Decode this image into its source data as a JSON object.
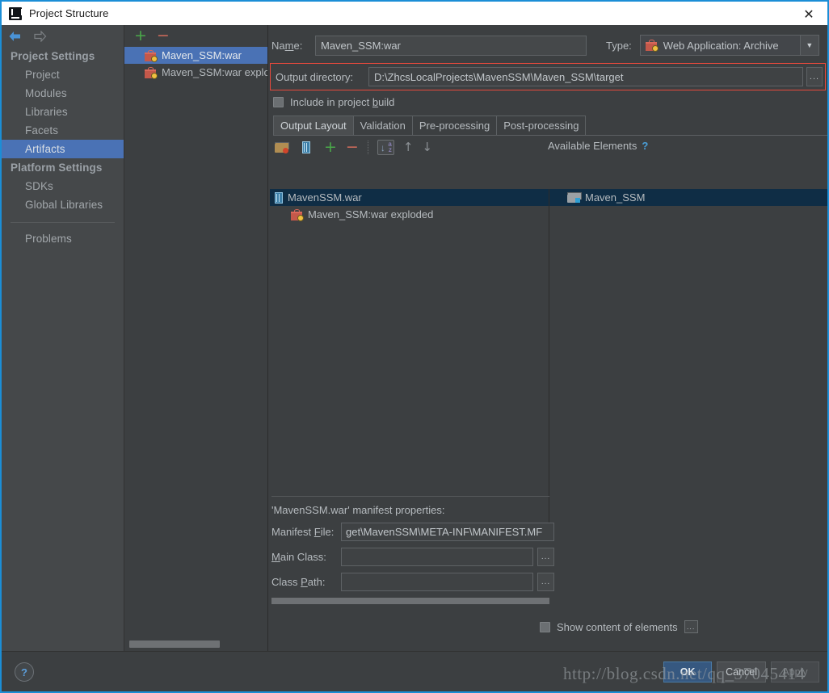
{
  "window": {
    "title": "Project Structure",
    "icon": "intellij-idea-icon",
    "close_label": "✕"
  },
  "nav": {
    "back_icon": "back-arrow-icon",
    "forward_icon": "forward-arrow-icon",
    "groups": [
      {
        "label": "Project Settings",
        "items": [
          {
            "label": "Project",
            "selected": false
          },
          {
            "label": "Modules",
            "selected": false
          },
          {
            "label": "Libraries",
            "selected": false
          },
          {
            "label": "Facets",
            "selected": false
          },
          {
            "label": "Artifacts",
            "selected": true
          }
        ]
      },
      {
        "label": "Platform Settings",
        "items": [
          {
            "label": "SDKs",
            "selected": false
          },
          {
            "label": "Global Libraries",
            "selected": false
          }
        ]
      }
    ],
    "problems_label": "Problems",
    "help_label": "?"
  },
  "artifacts_panel": {
    "add_label": "+",
    "remove_label": "−",
    "items": [
      {
        "label": "Maven_SSM:war",
        "selected": true
      },
      {
        "label": "Maven_SSM:war exploded",
        "selected": false
      }
    ]
  },
  "detail": {
    "name_label": "Na",
    "name_label_mnemonic": "m",
    "name_label_rest": "e:",
    "name_value": "Maven_SSM:war",
    "type_label": "Type:",
    "type_value": "Web Application: Archive",
    "type_caret": "▼",
    "output_dir_label": "Output directory:",
    "output_dir_value": "D:\\ZhcsLocalProjects\\MavenSSM\\Maven_SSM\\target",
    "output_dir_browse": "...",
    "include_checkbox_label_a": "Include in project ",
    "include_checkbox_label_mnemonic": "b",
    "include_checkbox_label_b": "uild",
    "include_checked": false,
    "tabs": [
      {
        "label": "Output Layout",
        "active": true
      },
      {
        "label": "Validation",
        "active": false
      },
      {
        "label": "Pre-processing",
        "active": false
      },
      {
        "label": "Post-processing",
        "active": false
      }
    ]
  },
  "output_layout": {
    "toolbar": [
      {
        "name": "create-directory-icon",
        "label": ""
      },
      {
        "name": "create-archive-icon",
        "label": ""
      },
      {
        "name": "add-icon",
        "label": "+"
      },
      {
        "name": "remove-icon",
        "label": "−"
      },
      {
        "name": "sort-alphabetically-icon",
        "label": ""
      },
      {
        "name": "move-up-icon",
        "label": "↑"
      },
      {
        "name": "move-down-icon",
        "label": "↓"
      }
    ],
    "available_elements_label": "Available Elements",
    "available_help": "?",
    "tree": [
      {
        "label": "MavenSSM.war",
        "icon": "war-archive-icon",
        "selected": true,
        "indent": false
      },
      {
        "label": "Maven_SSM:war exploded",
        "icon": "artifact-icon",
        "selected": false,
        "indent": true
      }
    ],
    "available": [
      {
        "label": "Maven_SSM",
        "icon": "module-icon",
        "selected": true
      }
    ]
  },
  "manifest": {
    "title": "'MavenSSM.war' manifest properties:",
    "file_label_a": "Manifest ",
    "file_label_mnemonic": "F",
    "file_label_b": "ile:",
    "file_value": "get\\MavenSSM\\META-INF\\MANIFEST.MF",
    "main_class_label_mnemonic": "M",
    "main_class_label_rest": "ain Class:",
    "main_class_value": "",
    "main_class_browse": "...",
    "class_path_label_a": "Class ",
    "class_path_label_mnemonic": "P",
    "class_path_label_b": "ath:",
    "class_path_value": "",
    "class_path_browse": "...",
    "show_content_label": "Show content of elements",
    "show_content_checked": false,
    "show_content_browse": "..."
  },
  "footer": {
    "ok_label": "OK",
    "cancel_label": "Cancel",
    "apply_label": "Apply"
  },
  "watermark": "http://blog.csdn.net/qq_37045414",
  "colors": {
    "window_bg": "#3c3f41",
    "nav_bg": "#45484a",
    "selection_blue": "#4a72b5",
    "tree_selection": "#0f2d45",
    "highlight_red": "#e8493c",
    "accent_blue": "#1b8ed6",
    "ok_button": "#365880",
    "plus_green": "#4aa84a",
    "minus_red": "#cc6a5b"
  }
}
